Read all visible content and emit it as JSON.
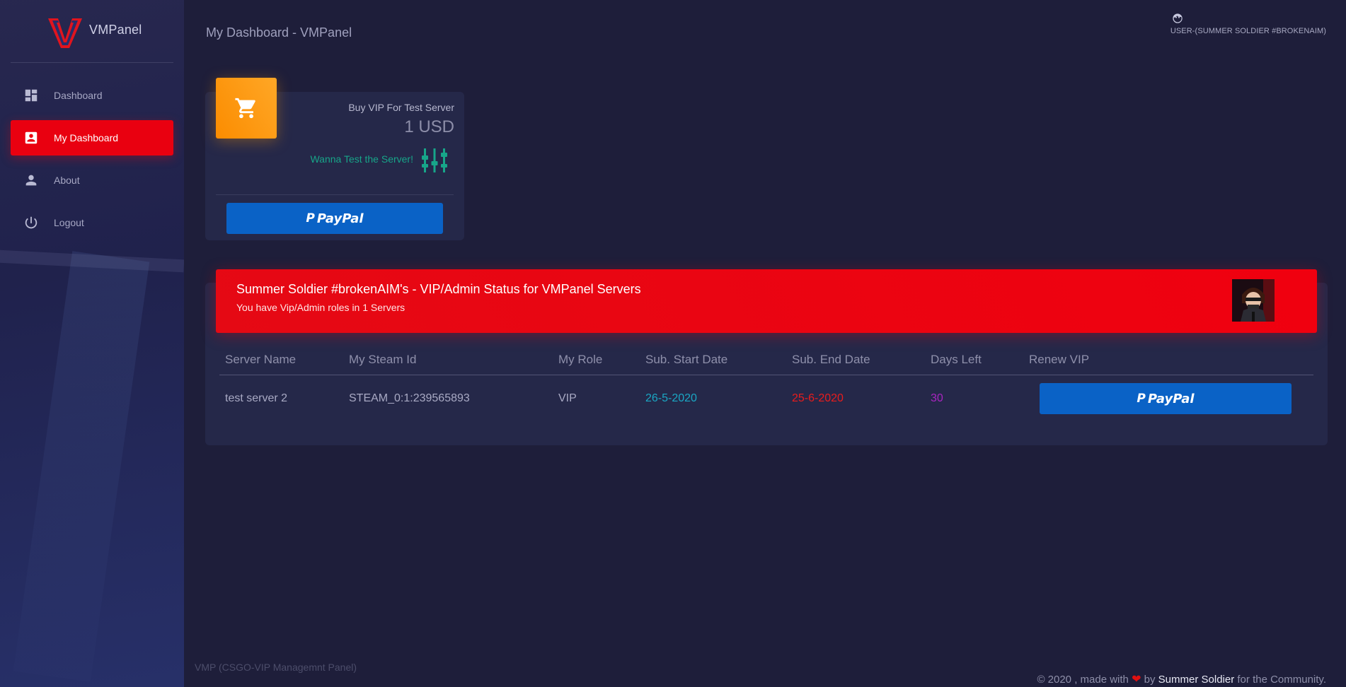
{
  "app": {
    "name": "VMPanel"
  },
  "sidebar": {
    "items": [
      {
        "label": "Dashboard",
        "icon": "dashboard-icon",
        "active": false
      },
      {
        "label": "My Dashboard",
        "icon": "account-box-icon",
        "active": true
      },
      {
        "label": "About",
        "icon": "person-icon",
        "active": false
      },
      {
        "label": "Logout",
        "icon": "power-icon",
        "active": false
      }
    ]
  },
  "header": {
    "title": "My Dashboard - VMPanel",
    "user_label": "USER-(SUMMER SOLDIER #BROKENAIM)"
  },
  "vip_card": {
    "title": "Buy VIP For Test Server",
    "price": "1 USD",
    "note": "Wanna Test the Server!",
    "icon": "cart-icon",
    "button_label": "PayPal"
  },
  "status": {
    "title": "Summer Soldier #brokenAIM's - VIP/Admin Status for VMPanel Servers",
    "subtitle": "You have Vip/Admin roles in 1 Servers",
    "columns": [
      "Server Name",
      "My Steam Id",
      "My Role",
      "Sub. Start Date",
      "Sub. End Date",
      "Days Left",
      "Renew VIP"
    ],
    "rows": [
      {
        "server_name": "test server 2",
        "steam_id": "STEAM_0:1:239565893",
        "role": "VIP",
        "start_date": "26-5-2020",
        "end_date": "25-6-2020",
        "days_left": "30",
        "renew_label": "PayPal"
      }
    ]
  },
  "footer": {
    "left": "VMP (CSGO-VIP Managemnt Panel)",
    "right_prefix": "© 2020 , made with",
    "right_by": "by",
    "right_author": "Summer Soldier",
    "right_suffix": "for the Community."
  },
  "colors": {
    "accent": "#e90010",
    "orange": "#fb8c00",
    "paypal": "#0a62c6",
    "teal": "#17a589",
    "start": "#1aa7c4",
    "end": "#ea1c1c",
    "days": "#a925c0"
  }
}
